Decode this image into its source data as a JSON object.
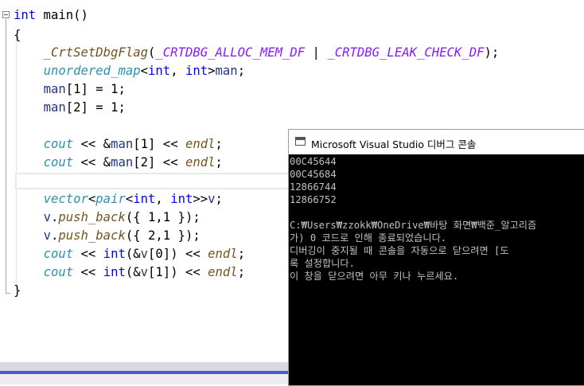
{
  "editor": {
    "code": [
      [
        {
          "t": "int",
          "c": "kw"
        },
        {
          "t": " main()"
        }
      ],
      [
        {
          "t": "{"
        }
      ],
      [
        {
          "t": "    "
        },
        {
          "t": "_CrtSetDbgFlag",
          "c": "fn"
        },
        {
          "t": "("
        },
        {
          "t": "_CRTDBG_ALLOC_MEM_DF",
          "c": "mac"
        },
        {
          "t": " | "
        },
        {
          "t": "_CRTDBG_LEAK_CHECK_DF",
          "c": "mac"
        },
        {
          "t": ");"
        }
      ],
      [
        {
          "t": "    "
        },
        {
          "t": "unordered_map",
          "c": "ty"
        },
        {
          "t": "<"
        },
        {
          "t": "int",
          "c": "kw"
        },
        {
          "t": ", "
        },
        {
          "t": "int",
          "c": "kw"
        },
        {
          "t": ">"
        },
        {
          "t": "man",
          "c": "var"
        },
        {
          "t": ";"
        }
      ],
      [
        {
          "t": "    "
        },
        {
          "t": "man",
          "c": "var"
        },
        {
          "t": "[1] = 1;"
        }
      ],
      [
        {
          "t": "    "
        },
        {
          "t": "man",
          "c": "var"
        },
        {
          "t": "[2] = 1;"
        }
      ],
      [
        {
          "t": ""
        }
      ],
      [
        {
          "t": "    "
        },
        {
          "t": "cout",
          "c": "ty"
        },
        {
          "t": " << &"
        },
        {
          "t": "man",
          "c": "var"
        },
        {
          "t": "[1] << "
        },
        {
          "t": "endl",
          "c": "fn"
        },
        {
          "t": ";"
        }
      ],
      [
        {
          "t": "    "
        },
        {
          "t": "cout",
          "c": "ty"
        },
        {
          "t": " << &"
        },
        {
          "t": "man",
          "c": "var"
        },
        {
          "t": "[2] << "
        },
        {
          "t": "endl",
          "c": "fn"
        },
        {
          "t": ";"
        }
      ],
      [
        {
          "t": ""
        }
      ],
      [
        {
          "t": "    "
        },
        {
          "t": "vector",
          "c": "ty"
        },
        {
          "t": "<"
        },
        {
          "t": "pair",
          "c": "ty"
        },
        {
          "t": "<"
        },
        {
          "t": "int",
          "c": "kw"
        },
        {
          "t": ", "
        },
        {
          "t": "int",
          "c": "kw"
        },
        {
          "t": ">>"
        },
        {
          "t": "v",
          "c": "var"
        },
        {
          "t": ";"
        }
      ],
      [
        {
          "t": "    "
        },
        {
          "t": "v",
          "c": "var"
        },
        {
          "t": "."
        },
        {
          "t": "push_back",
          "c": "fn"
        },
        {
          "t": "({ 1,1 });"
        }
      ],
      [
        {
          "t": "    "
        },
        {
          "t": "v",
          "c": "var"
        },
        {
          "t": "."
        },
        {
          "t": "push_back",
          "c": "fn"
        },
        {
          "t": "({ 2,1 });"
        }
      ],
      [
        {
          "t": "    "
        },
        {
          "t": "cout",
          "c": "ty"
        },
        {
          "t": " << "
        },
        {
          "t": "int",
          "c": "kw"
        },
        {
          "t": "(&"
        },
        {
          "t": "v",
          "c": "var"
        },
        {
          "t": "[0]) << "
        },
        {
          "t": "endl",
          "c": "fn"
        },
        {
          "t": ";"
        }
      ],
      [
        {
          "t": "    "
        },
        {
          "t": "cout",
          "c": "ty"
        },
        {
          "t": " << "
        },
        {
          "t": "int",
          "c": "kw"
        },
        {
          "t": "(&"
        },
        {
          "t": "v",
          "c": "var"
        },
        {
          "t": "[1]) << "
        },
        {
          "t": "endl",
          "c": "fn"
        },
        {
          "t": ";"
        }
      ],
      [
        {
          "t": "}"
        }
      ]
    ]
  },
  "console": {
    "title": "Microsoft Visual Studio 디버그 콘솔",
    "lines": [
      "00C45644",
      "00C45684",
      "12866744",
      "12866752",
      "",
      "C:₩Users₩zzokk₩OneDrive₩바탕 화면₩백준_알고리즘",
      "가) 0 코드로 인해 종료되었습니다.",
      "디버깅이 중지될 때 콘솔을 자동으로 닫으려면 [도",
      "록 설정합니다.",
      "이 창을 닫으려면 아무 키나 누르세요."
    ]
  },
  "colors": {
    "keyword": "#0000ff",
    "type": "#2b91af",
    "function": "#74531f",
    "macro": "#8a1bff",
    "variable": "#1f377f",
    "console_bg": "#000000",
    "console_text": "#c0c0c0"
  }
}
